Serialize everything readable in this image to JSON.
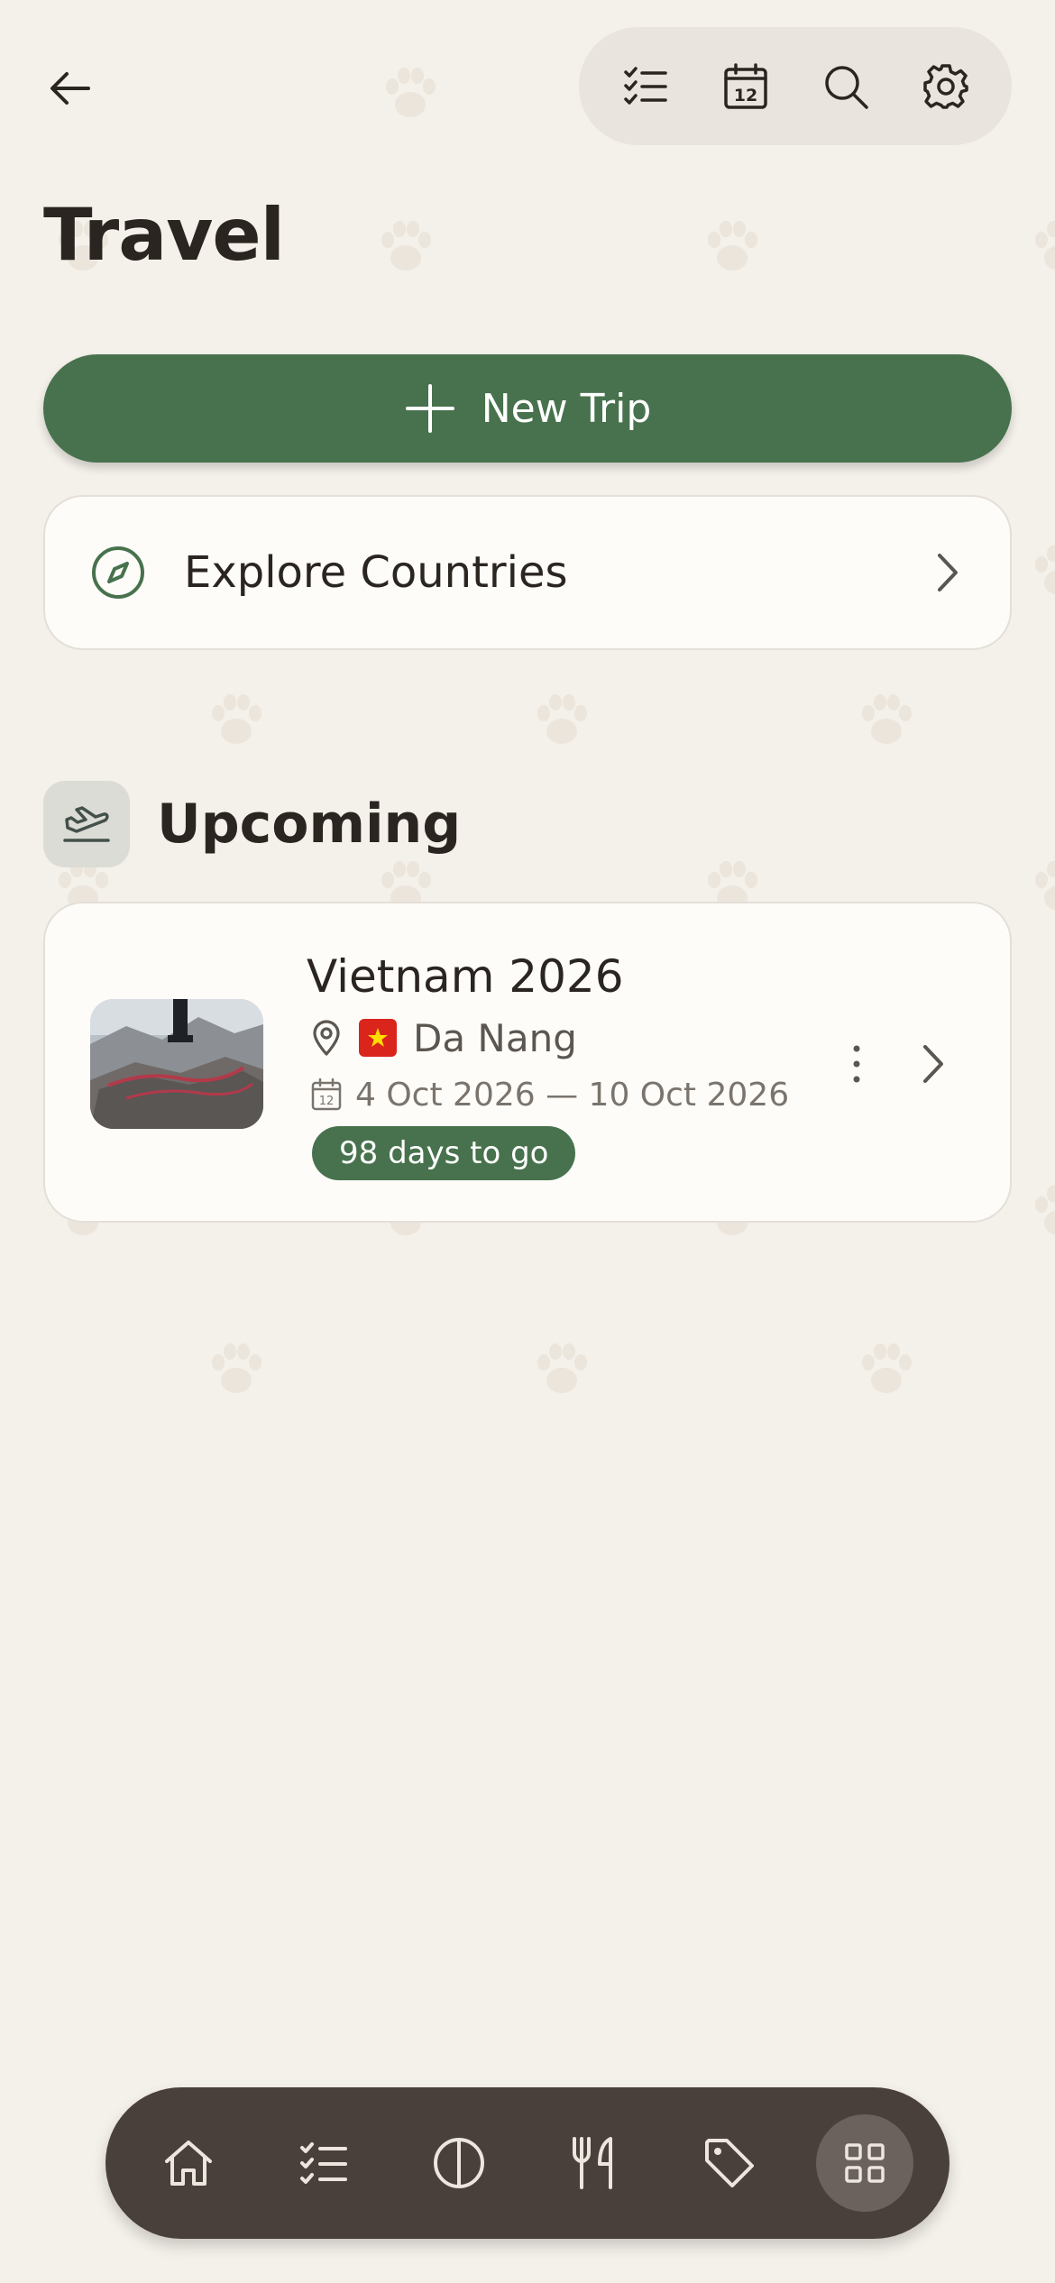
{
  "header": {
    "back_icon": "arrow-left-icon",
    "actions": [
      "checklist-icon",
      "calendar-icon",
      "search-icon",
      "gear-icon"
    ],
    "calendar_day": "12",
    "title": "Travel"
  },
  "new_trip": {
    "label": "New Trip",
    "icon": "plus-icon"
  },
  "explore": {
    "label": "Explore Countries",
    "icon": "compass-icon"
  },
  "upcoming": {
    "title": "Upcoming",
    "icon": "airplane-departure-icon",
    "trips": [
      {
        "name": "Vietnam 2026",
        "location": "Da Nang",
        "flag": "vietnam-flag",
        "dates": "4 Oct 2026 — 10 Oct 2026",
        "calendar_day": "12",
        "countdown": "98 days to go"
      }
    ]
  },
  "bottom_nav": {
    "items": [
      "home-icon",
      "checklist-icon",
      "half-circle-icon",
      "fork-knife-icon",
      "tag-icon",
      "grid-icon"
    ],
    "active": "grid-icon"
  },
  "colors": {
    "background": "#f4f0ea",
    "accent": "#47724d",
    "card": "#fdfcf9",
    "nav": "#4a403b"
  }
}
